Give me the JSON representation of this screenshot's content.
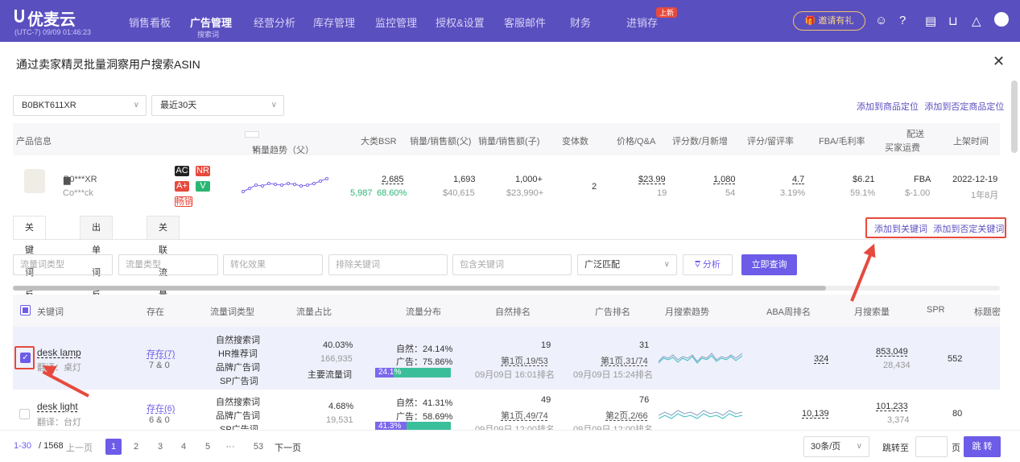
{
  "app": {
    "logo": "优麦云",
    "timezone": "(UTC-7) 09/09 01:46:23",
    "nav": [
      "销售看板",
      "广告管理",
      "经营分析",
      "库存管理",
      "监控管理",
      "授权&设置",
      "客服邮件",
      "财务",
      "进销存"
    ],
    "nav_sub": "搜索词",
    "new_badge": "上新",
    "invite": "邀请有礼"
  },
  "modal": {
    "title": "通过卖家精灵批量洞察用户搜索ASIN",
    "asin_select": "B0BKT611XR",
    "range_select": "最近30天",
    "link_add_product": "添加到商品定位",
    "link_add_neg_product": "添加到否定商品定位"
  },
  "product_header": [
    "产品信息",
    "销量趋势（父）",
    "大类BSR",
    "销量/销售额(父)",
    "销量/销售额(子)",
    "变体数",
    "价格/Q&A",
    "评分数/月新增",
    "评分/留评率",
    "FBA/毛利率",
    "配送",
    "买家运费",
    "上架时间"
  ],
  "product": {
    "asin": "B0***XR",
    "brand": "Co***ck",
    "badges": [
      "AC",
      "NR",
      "A+",
      "V"
    ],
    "tag": "畅销",
    "bsr": "2,685",
    "bsr_sub1": "5,987",
    "bsr_sub2": "68.60%",
    "parent_sales": "1,693",
    "parent_rev": "$40,615",
    "child_sales": "1,000+",
    "child_rev": "$23,990+",
    "variants": "2",
    "price": "$23.99",
    "qa": "19",
    "ratings": "1,080",
    "new_ratings": "54",
    "score": "4.7",
    "review_rate": "3.19%",
    "fba": "$6.21",
    "margin": "59.1%",
    "ship": "FBA",
    "ship_fee": "$-1.00",
    "date": "2022-12-19",
    "age": "1年8月"
  },
  "tabs": [
    "关键词反查",
    "出单词反查",
    "关联流量"
  ],
  "links": {
    "add_kw": "添加到关键词",
    "add_neg_kw": "添加到否定关键词"
  },
  "filters": {
    "f1": "流量词类型",
    "f2": "流量类型",
    "f3": "转化效果",
    "f4": "排除关键词",
    "f5": "包含关键词",
    "match": "广泛匹配",
    "analyze": "分析",
    "query": "立即查询"
  },
  "table_header": [
    "关键词",
    "存在",
    "流量词类型",
    "流量占比",
    "流量分布",
    "自然排名",
    "广告排名",
    "月搜索趋势",
    "ABA周排名",
    "月搜索量",
    "SPR",
    "标题密"
  ],
  "rows": [
    {
      "kw": "desk lamp",
      "trans": "翻译：桌灯",
      "exist": "存在(7)",
      "exist_sub": "7 & 0",
      "types": [
        "自然搜索词",
        "HR推荐词",
        "品牌广告词",
        "SP广告词"
      ],
      "share": "40.03%",
      "share_n": "166,935",
      "share_tag": "主要流量词",
      "nat": "自然：24.14%",
      "ad": "广告：75.86%",
      "bar_pct": 24.1,
      "bar_label": "24.1%",
      "nrank": "19",
      "nrank_pg": "第1页,19/53",
      "nrank_t": "09月09日 16:01排名",
      "arank": "31",
      "arank_pg": "第1页,31/74",
      "arank_t": "09月09日 15:24排名",
      "aba": "324",
      "vol": "853,049",
      "vol_sub": "28,434",
      "spr": "552"
    },
    {
      "kw": "desk light",
      "trans": "翻译：台灯",
      "exist": "存在(6)",
      "exist_sub": "6 & 0",
      "types": [
        "自然搜索词",
        "品牌广告词",
        "SP广告词"
      ],
      "share": "4.68%",
      "share_n": "19,531",
      "share_tag": "",
      "nat": "自然：41.31%",
      "ad": "广告：58.69%",
      "bar_pct": 41.3,
      "bar_label": "41.3%",
      "nrank": "49",
      "nrank_pg": "第1页,49/74",
      "nrank_t": "09月09日 12:00排名",
      "arank": "76",
      "arank_pg": "第2页,2/66",
      "arank_t": "09月09日 12:00排名",
      "aba": "10,139",
      "vol": "101,233",
      "vol_sub": "3,374",
      "spr": "80"
    }
  ],
  "pager": {
    "range": "1-30",
    "total": "/ 1568",
    "prev": "上一页",
    "pages": [
      "1",
      "2",
      "3",
      "4",
      "5",
      "···",
      "53"
    ],
    "next": "下一页",
    "size": "30条/页",
    "goto": "跳转至",
    "page_unit": "页",
    "jump": "跳 转"
  }
}
